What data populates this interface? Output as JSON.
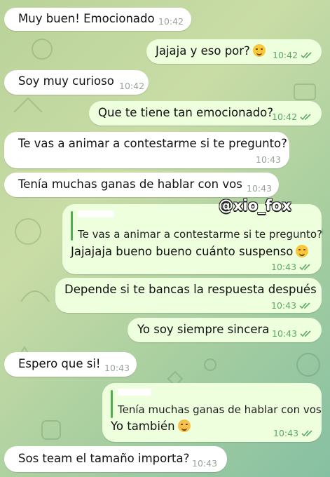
{
  "watermark": "@xio_fox",
  "messages": [
    {
      "text": "Muy buen! Emocionado",
      "time": "10:42"
    },
    {
      "text": "Jajaja y eso por?",
      "time": "10:42",
      "emoji": "wink-face-icon"
    },
    {
      "text": "Soy muy curioso",
      "time": "10:42"
    },
    {
      "text": "Que te tiene tan emocionado?",
      "time": "10:42"
    },
    {
      "text": "Te vas a animar a contestarme si te pregunto?",
      "time": "10:43"
    },
    {
      "text": "Tenía muchas ganas de hablar con vos",
      "time": "10:43"
    },
    {
      "reply_quote": "Te vas a animar a contestarme si te pregunto?",
      "text": "Jajajaja bueno bueno cuánto suspenso",
      "time": "10:43",
      "emoji": "laughing-tears-face-icon"
    },
    {
      "text": "Depende si te bancas la respuesta después",
      "time": "10:43"
    },
    {
      "text": "Yo soy siempre sincera",
      "time": "10:43"
    },
    {
      "text": "Espero que si!",
      "time": "10:43"
    },
    {
      "reply_quote": "Tenía muchas ganas de hablar con vos",
      "text": "Yo también",
      "time": "10:43",
      "emoji": "smiling-blush-face-icon"
    },
    {
      "text": "Sos team el tamaño importa?",
      "time": "10:43"
    }
  ],
  "colors": {
    "incoming_bubble": "#ffffff",
    "outgoing_bubble": "#eeffde",
    "read_ticks": "#5ea865",
    "reply_bar": "#4fae4e"
  }
}
